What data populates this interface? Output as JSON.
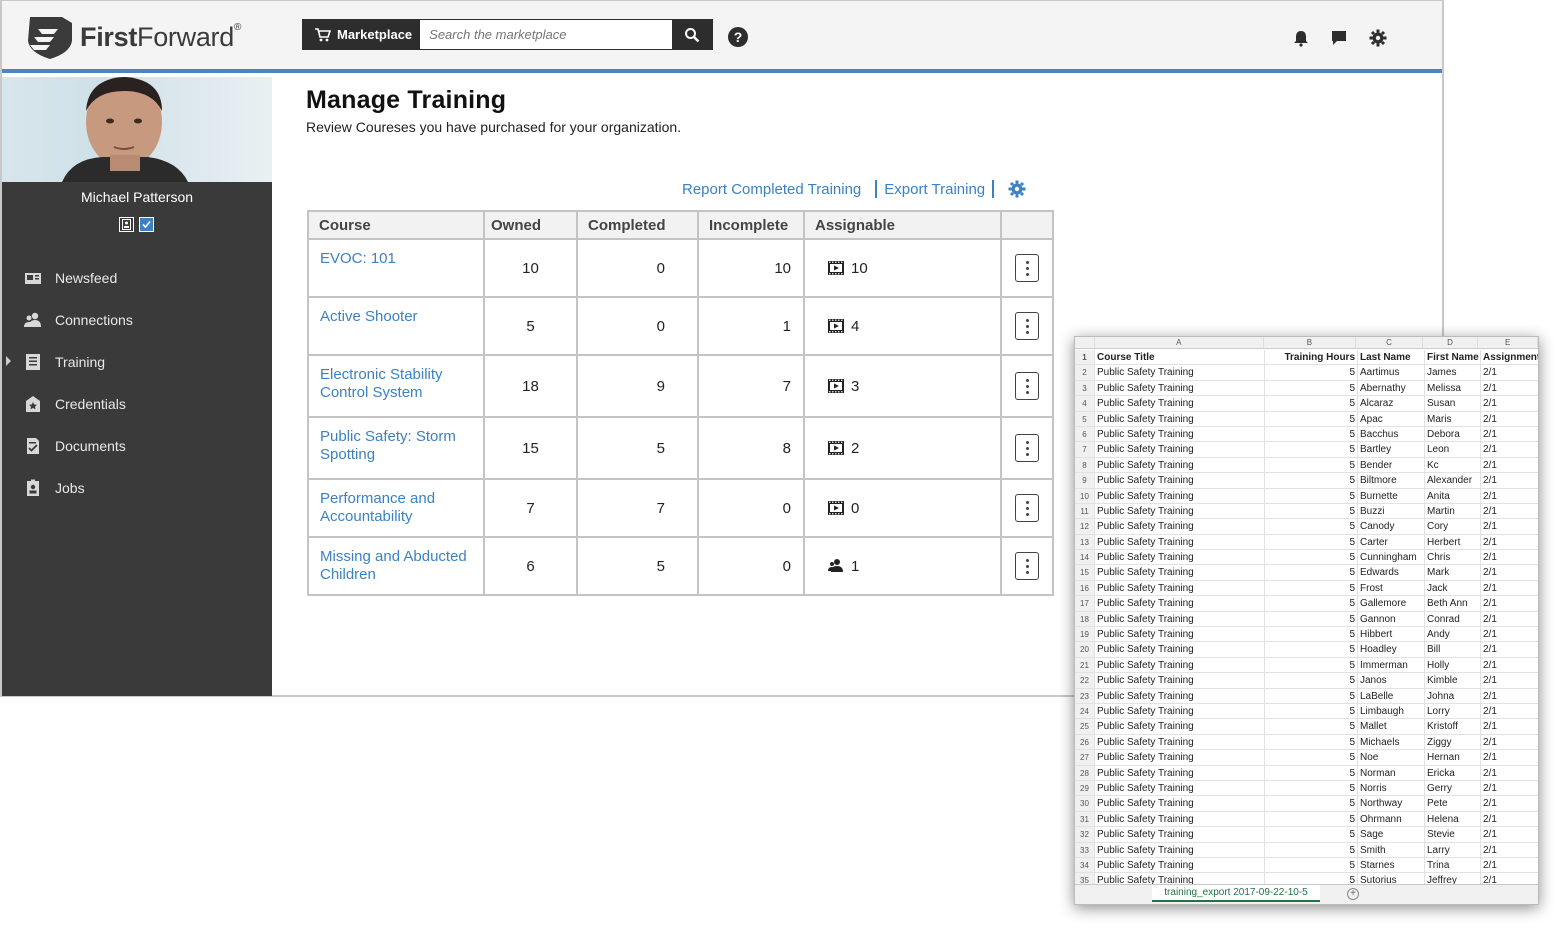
{
  "brand": {
    "name_bold": "First",
    "name_rest": "Forward",
    "reg": "®"
  },
  "header": {
    "marketplace_label": "Marketplace",
    "search_placeholder": "Search the marketplace",
    "help_label": "?"
  },
  "user": {
    "name": "Michael Patterson"
  },
  "nav": [
    {
      "label": "Newsfeed",
      "icon": "newspaper-icon"
    },
    {
      "label": "Connections",
      "icon": "connections-icon"
    },
    {
      "label": "Training",
      "icon": "training-icon",
      "active": true
    },
    {
      "label": "Credentials",
      "icon": "credentials-icon"
    },
    {
      "label": "Documents",
      "icon": "documents-icon"
    },
    {
      "label": "Jobs",
      "icon": "jobs-icon"
    }
  ],
  "page": {
    "title": "Manage Training",
    "subtitle": "Review Coureses you have purchased for your organization.",
    "link_report": "Report Completed Training",
    "link_export": "Export Training"
  },
  "table": {
    "headers": [
      "Course",
      "Owned",
      "Completed",
      "Incomplete",
      "Assignable"
    ],
    "rows": [
      {
        "course": "EVOC: 101",
        "owned": "10",
        "completed": "0",
        "incomplete": "10",
        "assignable": "10",
        "icon": "film-icon"
      },
      {
        "course": "Active Shooter",
        "owned": "5",
        "completed": "0",
        "incomplete": "1",
        "assignable": "4",
        "icon": "film-icon"
      },
      {
        "course": "Electronic Stability Control System",
        "owned": "18",
        "completed": "9",
        "incomplete": "7",
        "assignable": "3",
        "icon": "film-icon"
      },
      {
        "course": "Public Safety: Storm Spotting",
        "owned": "15",
        "completed": "5",
        "incomplete": "8",
        "assignable": "2",
        "icon": "film-icon"
      },
      {
        "course": "Performance and Accountability",
        "owned": "7",
        "completed": "7",
        "incomplete": "0",
        "assignable": "0",
        "icon": "film-icon"
      },
      {
        "course": "Missing and Abducted Children",
        "owned": "6",
        "completed": "5",
        "incomplete": "0",
        "assignable": "1",
        "icon": "person-icon"
      }
    ]
  },
  "spreadsheet": {
    "columns": [
      "A",
      "B",
      "C",
      "D",
      "E"
    ],
    "headers": [
      "Course Title",
      "Training Hours",
      "Last Name",
      "First Name",
      "Assignment"
    ],
    "course": "Public Safety Training",
    "hours": "5",
    "date_stub": "2/1",
    "people": [
      [
        "Aartimus",
        "James"
      ],
      [
        "Abernathy",
        "Melissa"
      ],
      [
        "Alcaraz",
        "Susan"
      ],
      [
        "Apac",
        "Maris"
      ],
      [
        "Bacchus",
        "Debora"
      ],
      [
        "Bartley",
        "Leon"
      ],
      [
        "Bender",
        "Kc"
      ],
      [
        "Biltmore",
        "Alexander"
      ],
      [
        "Burnette",
        "Anita"
      ],
      [
        "Buzzi",
        "Martin"
      ],
      [
        "Canody",
        "Cory"
      ],
      [
        "Carter",
        "Herbert"
      ],
      [
        "Cunningham",
        "Chris"
      ],
      [
        "Edwards",
        "Mark"
      ],
      [
        "Frost",
        "Jack"
      ],
      [
        "Gallemore",
        "Beth Ann"
      ],
      [
        "Gannon",
        "Conrad"
      ],
      [
        "Hibbert",
        "Andy"
      ],
      [
        "Hoadley",
        "Bill"
      ],
      [
        "Immerman",
        "Holly"
      ],
      [
        "Janos",
        "Kimble"
      ],
      [
        "LaBelle",
        "Johna"
      ],
      [
        "Limbaugh",
        "Lorry"
      ],
      [
        "Mallet",
        "Kristoff"
      ],
      [
        "Michaels",
        "Ziggy"
      ],
      [
        "Noe",
        "Hernan"
      ],
      [
        "Norman",
        "Ericka"
      ],
      [
        "Norris",
        "Gerry"
      ],
      [
        "Northway",
        "Pete"
      ],
      [
        "Ohrmann",
        "Helena"
      ],
      [
        "Sage",
        "Stevie"
      ],
      [
        "Smith",
        "Larry"
      ],
      [
        "Starnes",
        "Trina"
      ],
      [
        "Sutorius",
        "Jeffrey"
      ]
    ],
    "tab_name": "training_export 2017-09-22-10-5",
    "add_sheet": "+"
  },
  "colors": {
    "accent": "#3a82c4",
    "sidebar": "#3a3a3a",
    "header_bar": "#4a86c5",
    "sheet_tab": "#217346"
  }
}
